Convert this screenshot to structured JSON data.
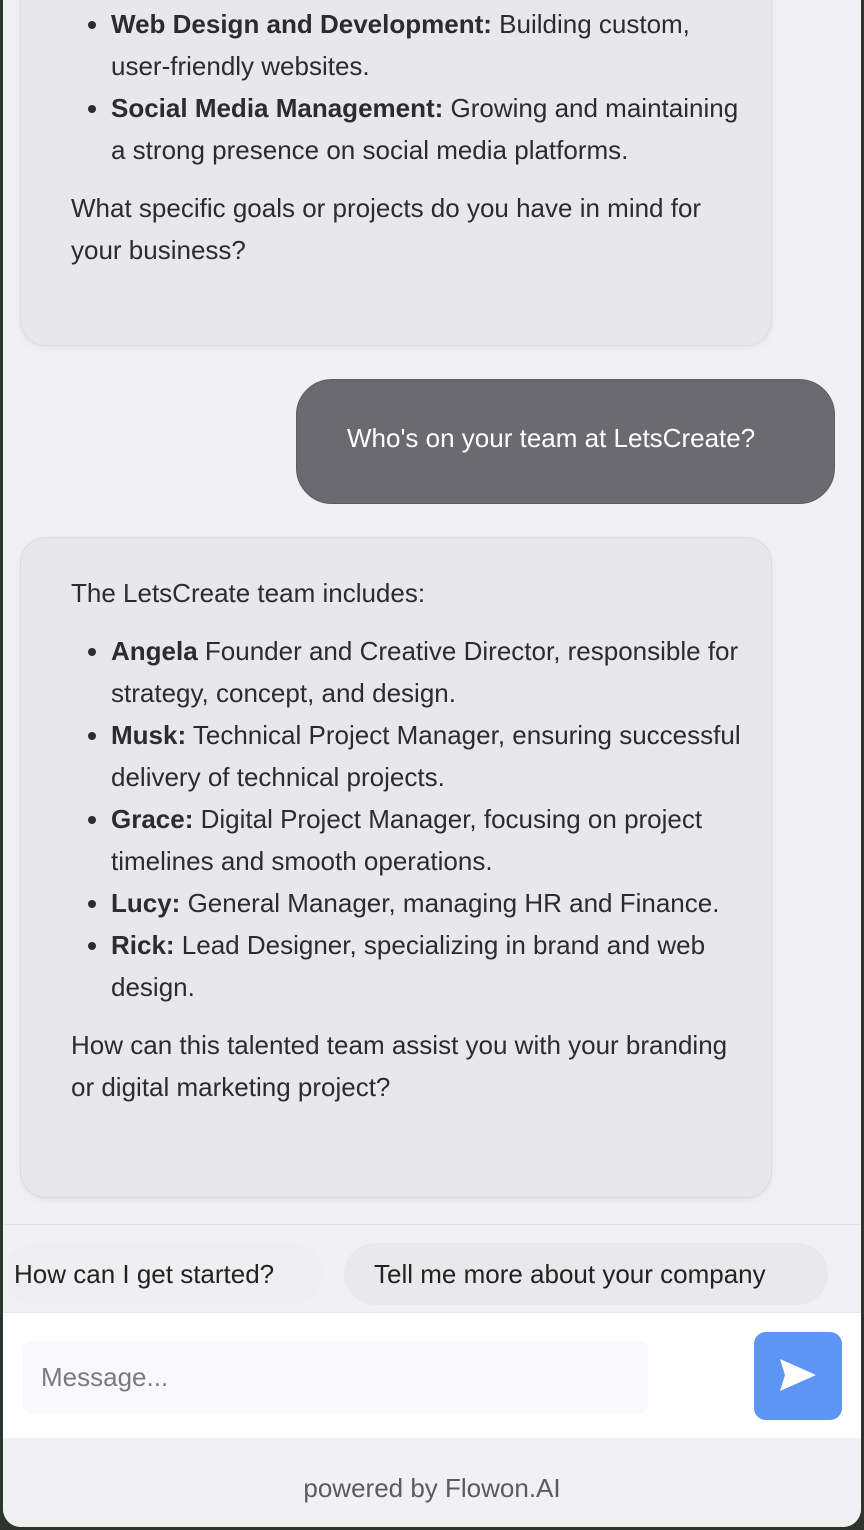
{
  "messages": {
    "bot_1": {
      "items": [
        {
          "bold": "Web Design and Development:",
          "text": " Building custom, user-friendly websites."
        },
        {
          "bold": "Social Media Management:",
          "text": " Growing and maintaining a strong presence on social media platforms."
        }
      ],
      "closing": "What specific goals or projects do you have in mind for your business?"
    },
    "user_1": "Who's on your team at LetsCreate?",
    "bot_2": {
      "intro": "The LetsCreate team includes:",
      "items": [
        {
          "bold": "Angela",
          "text": " Founder and Creative Director, responsible for strategy, concept, and design."
        },
        {
          "bold": "Musk:",
          "text": " Technical Project Manager, ensuring successful delivery of technical projects."
        },
        {
          "bold": "Grace:",
          "text": " Digital Project Manager, focusing on project timelines and smooth operations."
        },
        {
          "bold": "Lucy:",
          "text": " General Manager, managing HR and Finance."
        },
        {
          "bold": "Rick:",
          "text": " Lead Designer, specializing in brand and web design."
        }
      ],
      "closing": "How can this talented team assist you with your branding or digital marketing project?"
    }
  },
  "suggestions": [
    "How can I get started?",
    "Tell me more about your company"
  ],
  "composer": {
    "placeholder": "Message...",
    "value": ""
  },
  "send_button": {
    "icon": "send-icon",
    "color": "#5d95f5"
  },
  "footer": {
    "text": "powered by Flowon.AI"
  }
}
